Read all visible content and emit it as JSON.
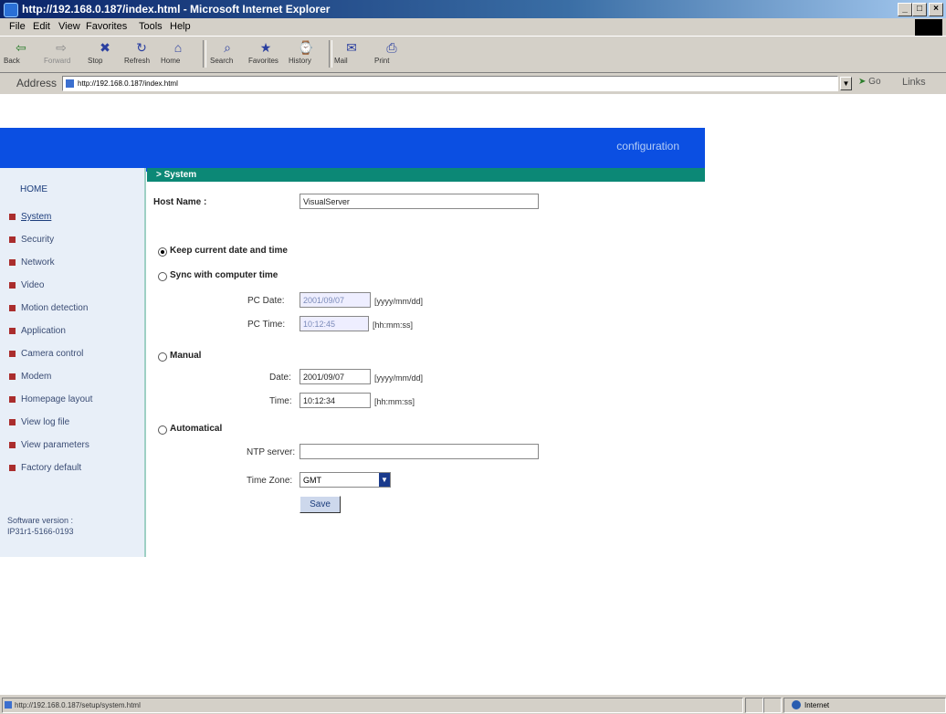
{
  "window": {
    "title": "http://192.168.0.187/index.html - Microsoft Internet Explorer",
    "minimize": "_",
    "maximize": "□",
    "close": "×"
  },
  "menu": [
    "File",
    "Edit",
    "View",
    "Favorites",
    "Tools",
    "Help"
  ],
  "toolbar": [
    {
      "label": "Back",
      "icon": "back-arrow-icon",
      "glyph": "⇦"
    },
    {
      "label": "Forward",
      "icon": "forward-arrow-icon",
      "glyph": "⇨"
    },
    {
      "label": "Stop",
      "icon": "stop-icon",
      "glyph": "✖"
    },
    {
      "label": "Refresh",
      "icon": "refresh-icon",
      "glyph": "↻"
    },
    {
      "label": "Home",
      "icon": "home-icon",
      "glyph": "⌂"
    },
    {
      "label": "Search",
      "icon": "search-icon",
      "glyph": "⌕"
    },
    {
      "label": "Favorites",
      "icon": "favorites-icon",
      "glyph": "★"
    },
    {
      "label": "History",
      "icon": "history-icon",
      "glyph": "⌚"
    },
    {
      "label": "Mail",
      "icon": "mail-icon",
      "glyph": "✉"
    },
    {
      "label": "Print",
      "icon": "print-icon",
      "glyph": "⎙"
    }
  ],
  "address": {
    "label": "Address",
    "url": "http://192.168.0.187/index.html",
    "go": "Go",
    "links": "Links"
  },
  "page": {
    "banner_title": "configuration",
    "section_title": "> System",
    "home": "HOME",
    "nav": [
      "System",
      "Security",
      "Network",
      "Video",
      "Motion detection",
      "Application",
      "Camera control",
      "Modem",
      "Homepage layout",
      "View log file",
      "View parameters",
      "Factory default"
    ],
    "software_version_label": "Software version :",
    "software_version": "IP31r1-5166-0193",
    "host_name_label": "Host Name :",
    "host_name_value": "VisualServer",
    "keep_time_label": "Keep current date and time",
    "sync_label": "Sync with computer time",
    "pc_date_label": "PC Date:",
    "pc_date_value": "2001/09/07",
    "date_format_hint": "[yyyy/mm/dd]",
    "pc_time_label": "PC Time:",
    "pc_time_value": "10:12:45",
    "time_format_hint": "[hh:mm:ss]",
    "manual_label": "Manual",
    "date_label": "Date:",
    "date_value": "2001/09/07",
    "time_label": "Time:",
    "time_value": "10:12:34",
    "auto_label": "Automatical",
    "ntp_label": "NTP server:",
    "ntp_value": "",
    "timezone_label": "Time Zone:",
    "timezone_value": "GMT",
    "save_label": "Save"
  },
  "status": {
    "url": "http://192.168.0.187/setup/system.html",
    "zone": "Internet"
  }
}
